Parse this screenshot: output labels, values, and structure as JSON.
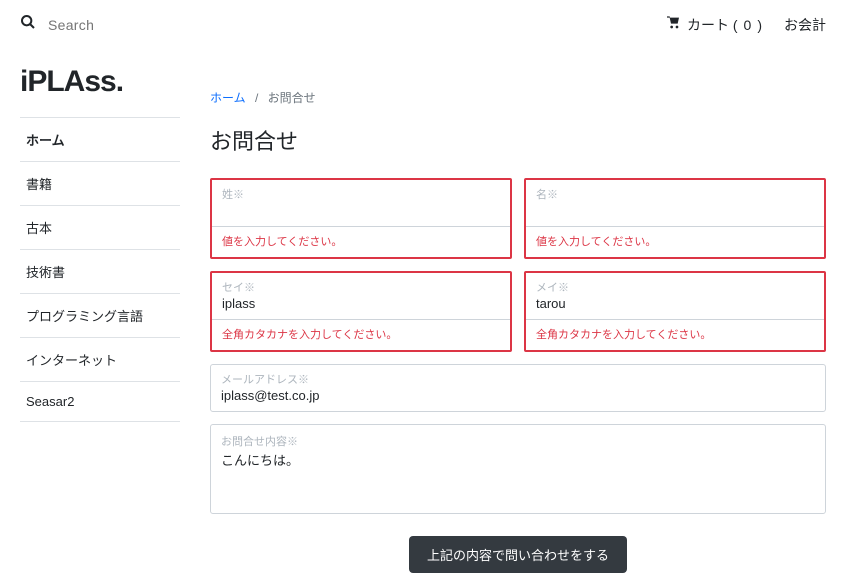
{
  "topbar": {
    "search_placeholder": "Search",
    "cart_label_prefix": "カート (",
    "cart_count": "0",
    "cart_label_suffix": ")",
    "checkout_label": "お会計"
  },
  "brand": "iPLAss.",
  "sidebar": {
    "items": [
      {
        "label": "ホーム"
      },
      {
        "label": "書籍"
      },
      {
        "label": "古本"
      },
      {
        "label": "技術書"
      },
      {
        "label": "プログラミング言語"
      },
      {
        "label": "インターネット"
      },
      {
        "label": "Seasar2"
      }
    ]
  },
  "breadcrumb": {
    "home_label": "ホーム",
    "sep": "/",
    "current": "お問合せ"
  },
  "page_title": "お問合せ",
  "form": {
    "last_name": {
      "label": "姓※",
      "value": "",
      "error": "値を入力してください。"
    },
    "first_name": {
      "label": "名※",
      "value": "",
      "error": "値を入力してください。"
    },
    "sei_kana": {
      "label": "セイ※",
      "value": "iplass",
      "error": "全角カタカナを入力してください。"
    },
    "mei_kana": {
      "label": "メイ※",
      "value": "tarou",
      "error": "全角カタカナを入力してください。"
    },
    "email": {
      "label": "メールアドレス※",
      "value": "iplass@test.co.jp"
    },
    "body": {
      "label": "お問合せ内容※",
      "value": "こんにちは。"
    },
    "submit_label": "上記の内容で問い合わせをする"
  }
}
